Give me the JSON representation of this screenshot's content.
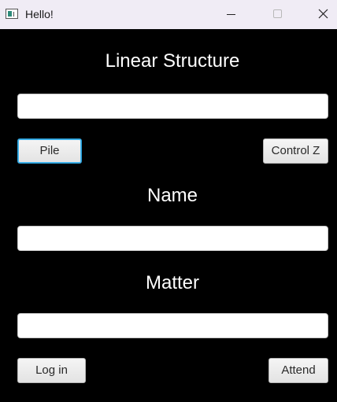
{
  "window": {
    "title": "Hello!",
    "controls": {
      "minimize_icon": "minimize-icon",
      "maximize_icon": "maximize-icon",
      "close_icon": "close-icon"
    }
  },
  "main": {
    "heading": "Linear Structure",
    "structure_input": {
      "value": "",
      "placeholder": ""
    },
    "pile_button": "Pile",
    "undo_button": "Control Z",
    "name_label": "Name",
    "name_input": {
      "value": "",
      "placeholder": ""
    },
    "matter_label": "Matter",
    "matter_input": {
      "value": "",
      "placeholder": ""
    },
    "login_button": "Log in",
    "attend_button": "Attend"
  },
  "colors": {
    "background": "#000000",
    "titlebar": "#f0ecf5",
    "focus_ring": "#2a9fd8"
  }
}
